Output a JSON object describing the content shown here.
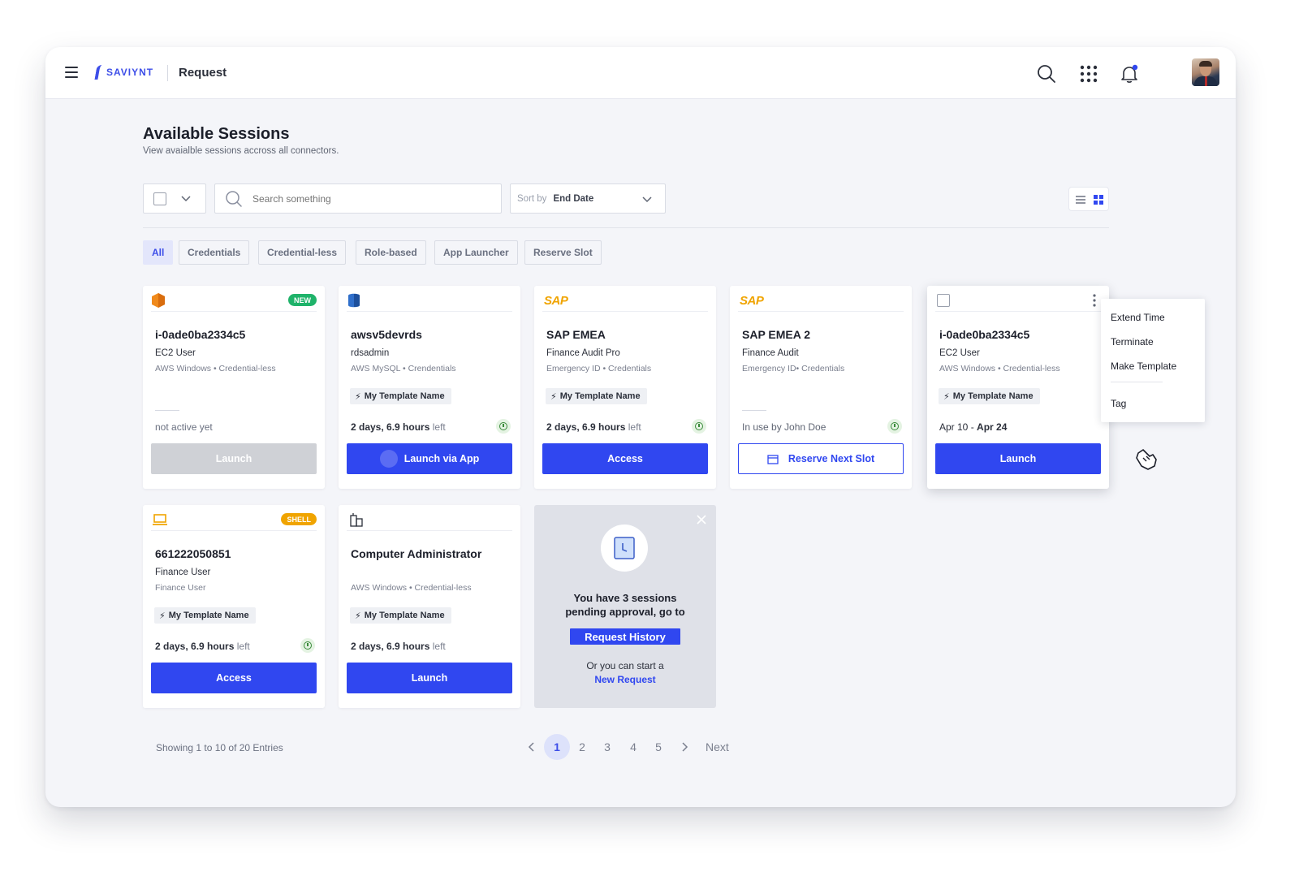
{
  "header": {
    "brand": "SAVIYNT",
    "app_title": "Request",
    "icons": [
      "menu-icon",
      "search-icon",
      "apps-grid-icon",
      "bell-icon",
      "avatar"
    ]
  },
  "page": {
    "title": "Available Sessions",
    "subtitle": "View avaialble sessions accross all connectors."
  },
  "toolbar": {
    "search_placeholder": "Search something",
    "sort_label": "Sort by",
    "sort_value": "End Date"
  },
  "filters": [
    "All",
    "Credentials",
    "Credential-less",
    "Role-based",
    "App Launcher",
    "Reserve Slot"
  ],
  "cards": [
    {
      "title": "i-0ade0ba2334c5",
      "line1": "EC2 User",
      "line2": "AWS Windows • Credential-less",
      "badge": "NEW",
      "status": "not active yet",
      "button": "Launch"
    },
    {
      "title": "awsv5devrds",
      "line1": "rdsadmin",
      "line2": "AWS MySQL • Crendentials",
      "template": "My Template Name",
      "status_bold": "2 days, 6.9 hours",
      "status_muted": "left",
      "button": "Launch via App"
    },
    {
      "title": "SAP EMEA",
      "logo": "SAP",
      "line1": "Finance Audit Pro",
      "line2": "Emergency ID • Credentials",
      "template": "My Template Name",
      "status_bold": "2 days, 6.9 hours",
      "status_muted": "left",
      "button": "Access"
    },
    {
      "title": "SAP EMEA 2",
      "logo": "SAP",
      "line1": "Finance Audit",
      "line2": "Emergency ID• Credentials",
      "status": "In use by John Doe",
      "button": "Reserve Next Slot"
    },
    {
      "title": "i-0ade0ba2334c5",
      "line1": "EC2 User",
      "line2": "AWS Windows • Credential-less",
      "template": "My Template Name",
      "status_start": "Apr 10",
      "status_sep": " - ",
      "status_end": "Apr 24",
      "button": "Launch"
    },
    {
      "title": "661222050851",
      "line1": "Finance User",
      "line2": "Finance User",
      "badge": "SHELL",
      "template": "My Template Name",
      "status_bold": "2 days, 6.9 hours",
      "status_muted": "left",
      "button": "Access"
    },
    {
      "title": "Computer Administrator",
      "line2": "AWS Windows • Credential-less",
      "template": "My Template Name",
      "status_bold": "2 days, 6.9 hours",
      "status_muted": "left",
      "button": "Launch"
    }
  ],
  "context_menu": [
    "Extend Time",
    "Terminate",
    "Make Template",
    "Tag"
  ],
  "promo": {
    "line1": "You have 3 sessions",
    "line2": "pending approval, go to",
    "button": "Request History",
    "small": "Or you can start a",
    "link": "New Request"
  },
  "footer": {
    "showing": "Showing 1 to 10 of 20 Entries",
    "pages": [
      "1",
      "2",
      "3",
      "4",
      "5"
    ],
    "next": "Next"
  },
  "colors": {
    "accent": "#3047f0",
    "new_badge": "#1fb36a",
    "shell_badge": "#f0a400",
    "sap": "#f0a400"
  }
}
